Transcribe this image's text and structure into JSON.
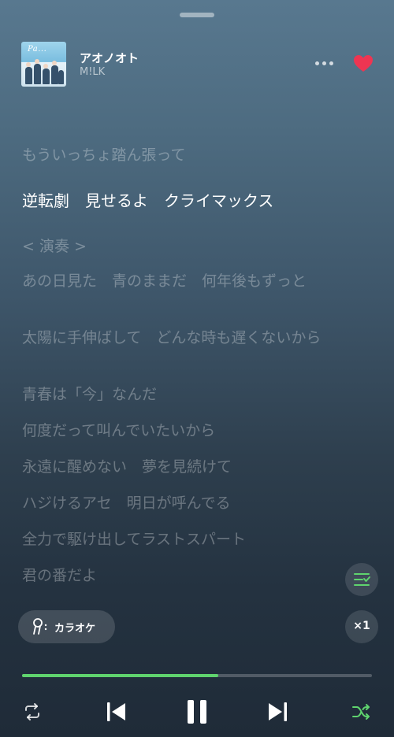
{
  "now_playing": {
    "title": "アオノオト",
    "artist": "M!LK",
    "artwork_icon": "album-cover",
    "more_icon": "more-dots-icon",
    "favorite_icon": "heart-icon",
    "favorited": true
  },
  "lyrics": {
    "lines": [
      "もういっちょ踏ん張って",
      "逆転劇　見せるよ　クライマックス",
      "< 演奏 >",
      "あの日見た　青のままだ　何年後もずっと",
      "太陽に手伸ばして　どんな時も遅くないから",
      "青春は「今」なんだ",
      "何度だって叫んでいたいから",
      "永遠に醒めない　夢を見続けて",
      "ハジけるアセ　明日が呼んでる",
      "全力で駆け出してラストスパート",
      "君の番だよ"
    ],
    "active_index": 1
  },
  "controls": {
    "karaoke_label": "カラオケ",
    "speed_label": "×1",
    "progress_fraction": 0.56,
    "queue_icon": "queue-list-icon",
    "repeat_icon": "repeat-icon",
    "previous_icon": "skip-previous-icon",
    "pause_icon": "pause-icon",
    "next_icon": "skip-next-icon",
    "shuffle_icon": "shuffle-icon"
  },
  "colors": {
    "accent_green": "#5fd46e",
    "heart_red": "#ee3552"
  }
}
